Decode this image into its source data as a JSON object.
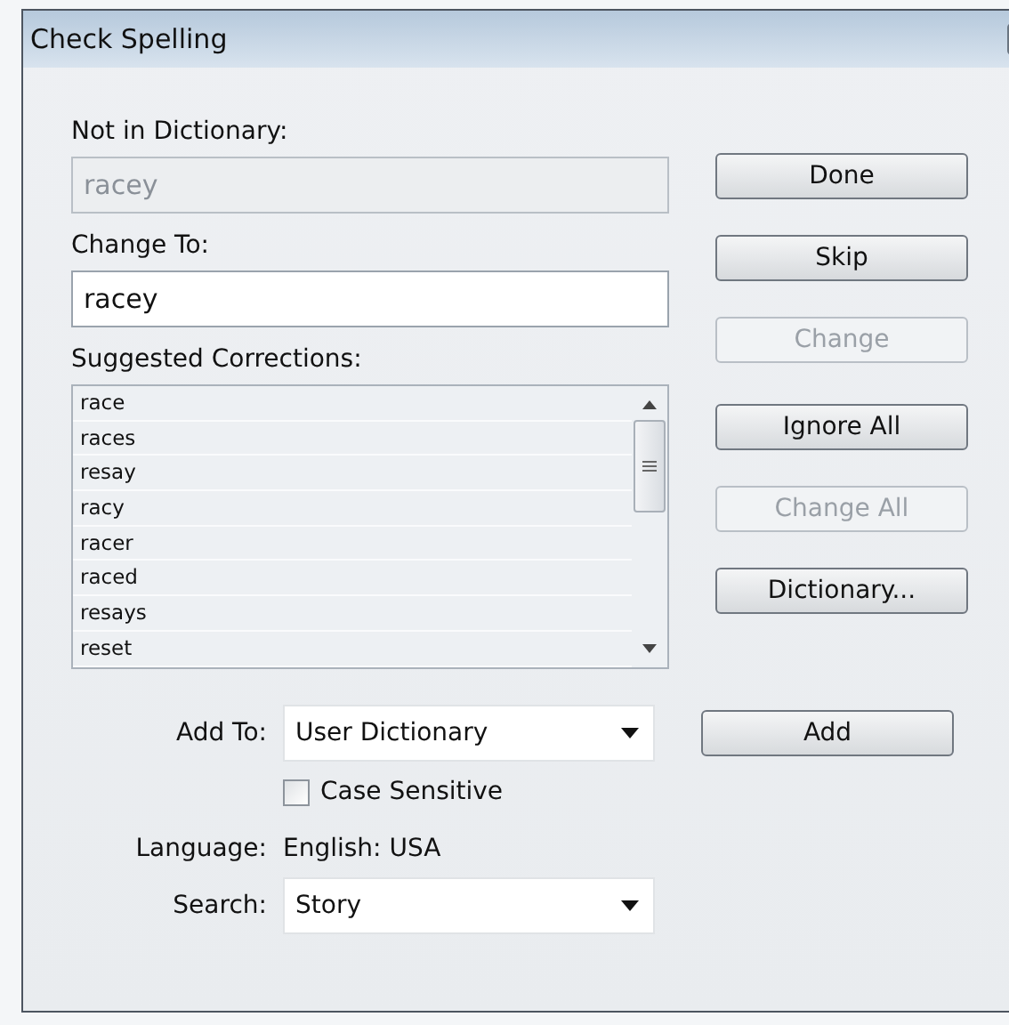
{
  "window": {
    "title": "Check Spelling"
  },
  "not_in_dictionary": {
    "label": "Not in Dictionary:",
    "value": "racey",
    "disabled": true
  },
  "change_to": {
    "label": "Change To:",
    "value": "racey"
  },
  "suggestions": {
    "label": "Suggested Corrections:",
    "items": [
      {
        "text": "race",
        "selected": false
      },
      {
        "text": "races",
        "selected": false
      },
      {
        "text": "resay",
        "selected": false
      },
      {
        "text": "racy",
        "selected": false
      },
      {
        "text": "racer",
        "selected": false
      },
      {
        "text": "raced",
        "selected": false
      },
      {
        "text": "resays",
        "selected": false
      },
      {
        "text": "reset",
        "selected": false
      }
    ]
  },
  "buttons": [
    {
      "label": "Done",
      "disabled": false
    },
    {
      "label": "Skip",
      "disabled": false
    },
    {
      "label": "Change",
      "disabled": true
    },
    {
      "label": "Ignore All",
      "disabled": false
    },
    {
      "label": "Change All",
      "disabled": true
    },
    {
      "label": "Dictionary...",
      "disabled": false
    }
  ],
  "add_to": {
    "label": "Add To:",
    "value": "User Dictionary",
    "button": "Add"
  },
  "case_sensitive": {
    "label": "Case Sensitive",
    "checked": false
  },
  "language": {
    "label": "Language:",
    "value": "English: USA"
  },
  "search": {
    "label": "Search:",
    "value": "Story"
  }
}
